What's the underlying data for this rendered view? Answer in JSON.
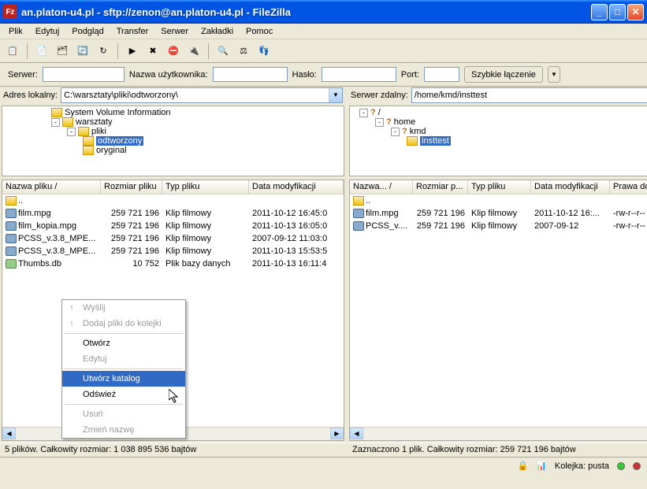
{
  "window": {
    "title": "an.platon-u4.pl - sftp://zenon@an.platon-u4.pl - FileZilla"
  },
  "menu": [
    "Plik",
    "Edytuj",
    "Podgląd",
    "Transfer",
    "Serwer",
    "Zakładki",
    "Pomoc"
  ],
  "quickconnect": {
    "serverLabel": "Serwer:",
    "server": "",
    "userLabel": "Nazwa użytkownika:",
    "user": "",
    "passLabel": "Hasło:",
    "pass": "",
    "portLabel": "Port:",
    "port": "",
    "button": "Szybkie łączenie"
  },
  "local": {
    "label": "Adres lokalny:",
    "path": "C:\\warsztaty\\pliki\\odtworzony\\",
    "tree": [
      {
        "indent": 60,
        "label": "System Volume Information",
        "folder": true
      },
      {
        "indent": 60,
        "label": "warsztaty",
        "exp": "-",
        "folder": true
      },
      {
        "indent": 80,
        "label": "pliki",
        "exp": "-",
        "folder": true
      },
      {
        "indent": 100,
        "label": "odtworzony",
        "folder": true,
        "sel": true
      },
      {
        "indent": 100,
        "label": "oryginal",
        "folder": true
      }
    ],
    "cols": [
      {
        "label": "Nazwa pliku",
        "w": 125,
        "sort": "/"
      },
      {
        "label": "Rozmiar pliku",
        "w": 78
      },
      {
        "label": "Typ pliku",
        "w": 110
      },
      {
        "label": "Data modyfikacji",
        "w": 120
      }
    ],
    "rows": [
      {
        "icon": "folder-up",
        "name": "..",
        "size": "",
        "type": "",
        "date": ""
      },
      {
        "icon": "video",
        "name": "film.mpg",
        "size": "259 721 196",
        "type": "Klip filmowy",
        "date": "2011-10-12 16:45:0"
      },
      {
        "icon": "video",
        "name": "film_kopia.mpg",
        "size": "259 721 196",
        "type": "Klip filmowy",
        "date": "2011-10-13 16:05:0"
      },
      {
        "icon": "video",
        "name": "PCSS_v.3.8_MPE...",
        "size": "259 721 196",
        "type": "Klip filmowy",
        "date": "2007-09-12 11:03:0"
      },
      {
        "icon": "video",
        "name": "PCSS_v.3.8_MPE...",
        "size": "259 721 196",
        "type": "Klip filmowy",
        "date": "2011-10-13 15:53:5"
      },
      {
        "icon": "db",
        "name": "Thumbs.db",
        "size": "10 752",
        "type": "Plik bazy danych",
        "date": "2011-10-13 16:11:4"
      }
    ],
    "status": "5 plików. Całkowity rozmiar: 1 038 895 536 bajtów"
  },
  "remote": {
    "label": "Serwer zdalny:",
    "path": "/home/kmd/insttest",
    "tree": [
      {
        "indent": 10,
        "label": "/",
        "exp": "-",
        "qmark": true
      },
      {
        "indent": 30,
        "label": "home",
        "exp": "-",
        "qmark": true
      },
      {
        "indent": 50,
        "label": "kmd",
        "exp": "-",
        "qmark": true
      },
      {
        "indent": 70,
        "label": "insttest",
        "folder": true,
        "sel": true
      }
    ],
    "cols": [
      {
        "label": "Nazwa...",
        "w": 80,
        "sort": "/"
      },
      {
        "label": "Rozmiar p...",
        "w": 70
      },
      {
        "label": "Typ pliku",
        "w": 80
      },
      {
        "label": "Data modyfikacji",
        "w": 100
      },
      {
        "label": "Prawa dos...",
        "w": 70
      }
    ],
    "rows": [
      {
        "icon": "folder-up",
        "name": "..",
        "size": "",
        "type": "",
        "date": "",
        "perm": ""
      },
      {
        "icon": "video",
        "name": "film.mpg",
        "size": "259 721 196",
        "type": "Klip filmowy",
        "date": "2011-10-12 16:...",
        "perm": "-rw-r--r--"
      },
      {
        "icon": "video",
        "name": "PCSS_v....",
        "size": "259 721 196",
        "type": "Klip filmowy",
        "date": "2007-09-12",
        "perm": "-rw-r--r--"
      }
    ],
    "status": "Zaznaczono 1 plik. Całkowity rozmiar: 259 721 196 bajtów"
  },
  "contextmenu": [
    {
      "label": "Wyślij",
      "disabled": true,
      "icon": "↑"
    },
    {
      "label": "Dodaj pliki do kolejki",
      "disabled": true,
      "icon": "↑"
    },
    {
      "sep": true
    },
    {
      "label": "Otwórz"
    },
    {
      "label": "Edytuj",
      "disabled": true
    },
    {
      "sep": true
    },
    {
      "label": "Utwórz katalog",
      "highlight": true
    },
    {
      "label": "Odśwież"
    },
    {
      "sep": true
    },
    {
      "label": "Usuń",
      "disabled": true
    },
    {
      "label": "Zmień nazwę",
      "disabled": true
    }
  ],
  "bottombar": {
    "queue": "Kolejka: pusta"
  }
}
